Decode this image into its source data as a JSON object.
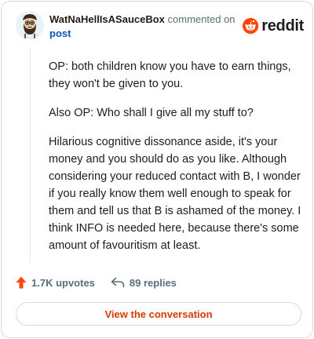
{
  "comment": {
    "author": "WatNaHellIsASauceBox",
    "action_text": "commented on",
    "post_link_label": "post",
    "paragraphs": [
      "OP: both children know you have to earn things, they won't be given to you.",
      "Also OP: Who shall I give all my stuff to?",
      "Hilarious cognitive dissonance aside, it's your money and you should do as you like. Although considering your reduced contact with B, I wonder if you really know them well enough to speak for them and tell us that B is ashamed of the money. I think INFO is needed here, because there's some amount of favouritism at least."
    ]
  },
  "brand": {
    "wordmark": "reddit",
    "color": "#ff4500"
  },
  "stats": {
    "upvotes_label": "1.7K upvotes",
    "replies_label": "89 replies",
    "upvote_icon": "upvote-arrow-icon",
    "reply_icon": "reply-arrow-icon"
  },
  "cta": {
    "label": "View the conversation",
    "color": "#d93a00"
  },
  "colors": {
    "link": "#0a55b8",
    "muted": "#576f76",
    "upvote": "#ff4500",
    "border": "#d9dadb"
  }
}
